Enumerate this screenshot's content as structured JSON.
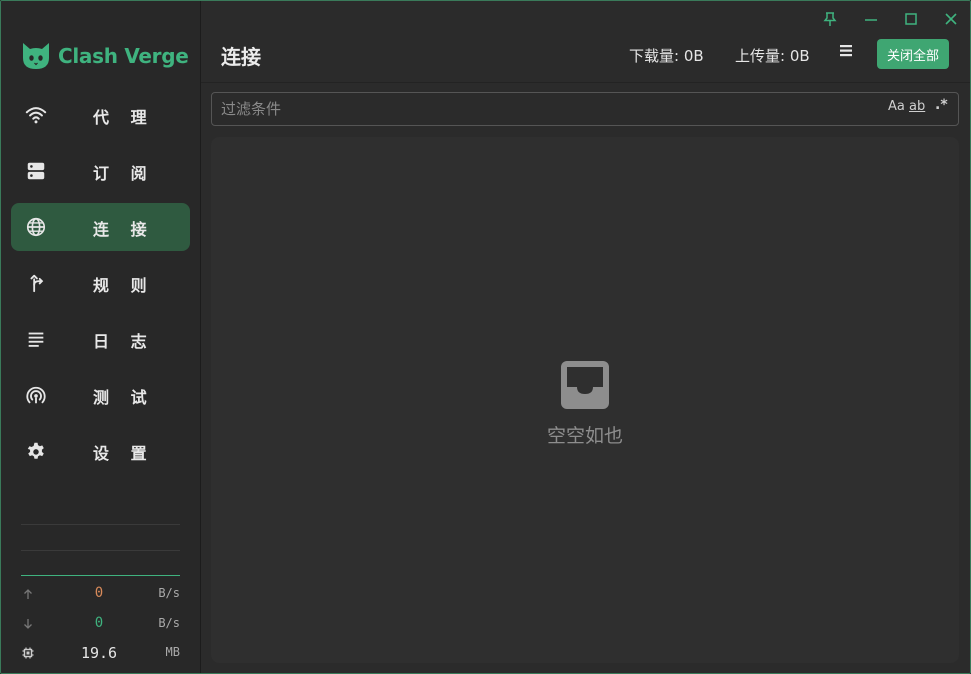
{
  "app": {
    "name": "Clash Verge"
  },
  "colors": {
    "accent": "#3fb37f",
    "active_nav_bg": "#2f5a40",
    "upload_value": "#d88a5a"
  },
  "sidebar": {
    "items": [
      {
        "label": "代 理",
        "icon": "wifi-icon"
      },
      {
        "label": "订 阅",
        "icon": "server-icon"
      },
      {
        "label": "连 接",
        "icon": "globe-icon"
      },
      {
        "label": "规 则",
        "icon": "fork-arrow-icon"
      },
      {
        "label": "日 志",
        "icon": "list-lines-icon"
      },
      {
        "label": "测 试",
        "icon": "signal-icon"
      },
      {
        "label": "设 置",
        "icon": "gear-icon"
      }
    ],
    "active_index": 2,
    "stats": {
      "upload": {
        "value": "0",
        "unit": "B/s"
      },
      "download": {
        "value": "0",
        "unit": "B/s"
      },
      "memory": {
        "value": "19.6",
        "unit": "MB"
      }
    }
  },
  "header": {
    "title": "连接",
    "download_label": "下载量: 0B",
    "upload_label": "上传量: 0B",
    "close_all_label": "关闭全部"
  },
  "filter": {
    "placeholder": "过滤条件",
    "value": "",
    "match_case_label": "Aa",
    "whole_word_label": "ab",
    "regex_label": ".*"
  },
  "content": {
    "empty_text": "空空如也"
  }
}
